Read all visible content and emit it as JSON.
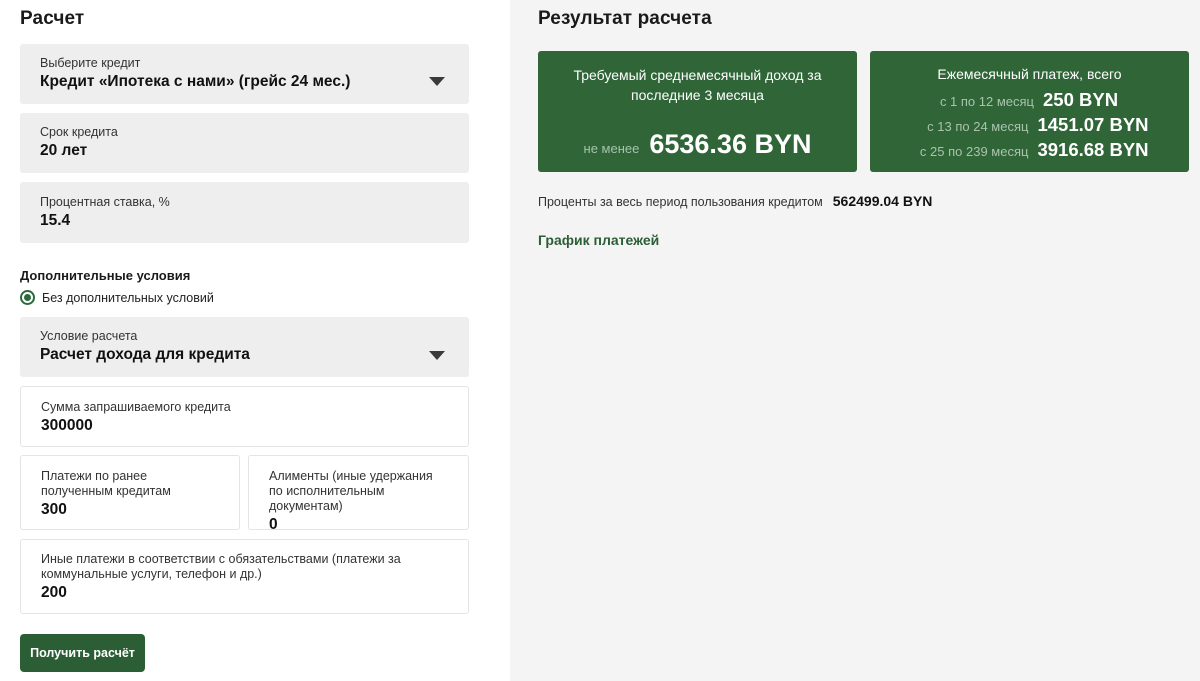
{
  "calc": {
    "title": "Расчет",
    "credit_select": {
      "label": "Выберите кредит",
      "value": "Кредит «Ипотека с нами» (грейс 24 мес.)"
    },
    "term": {
      "label": "Срок кредита",
      "value": "20 лет"
    },
    "rate": {
      "label": "Процентная ставка, %",
      "value": "15.4"
    },
    "additional": {
      "title": "Дополнительные условия",
      "radio_label": "Без дополнительных условий"
    },
    "condition_select": {
      "label": "Условие расчета",
      "value": "Расчет дохода для кредита"
    },
    "amount": {
      "label": "Сумма запрашиваемого кредита",
      "value": "300000"
    },
    "prev_payments": {
      "label": "Платежи по ранее полученным кредитам",
      "value": "300"
    },
    "alimony": {
      "label": "Алименты (иные удержания по исполнительным документам)",
      "value": "0"
    },
    "other_payments": {
      "label": "Иные платежи в соответствии с обязательствами (платежи за коммунальные услуги, телефон и др.)",
      "value": "200"
    },
    "submit_label": "Получить расчёт"
  },
  "result": {
    "title": "Результат расчета",
    "income_card": {
      "title": "Требуемый среднемесячный доход за последние 3 месяца",
      "prefix": "не менее",
      "value": "6536.36 BYN"
    },
    "payment_card": {
      "title": "Ежемесячный платеж, всего",
      "rows": [
        {
          "period": "с 1 по 12 месяц",
          "value": "250 BYN"
        },
        {
          "period": "с 13 по 24 месяц",
          "value": "1451.07 BYN"
        },
        {
          "period": "с 25 по 239 месяц",
          "value": "3916.68 BYN"
        }
      ]
    },
    "interest": {
      "label": "Проценты за весь период пользования кредитом",
      "value": "562499.04 BYN"
    },
    "schedule_link": "График платежей"
  },
  "colors": {
    "brand_green": "#2f6537",
    "button_green": "#2b5e35",
    "muted_text": "#a9c3ad"
  },
  "icons": {
    "select_caret": "caret-down-icon",
    "radio": "radio-selected-icon"
  }
}
